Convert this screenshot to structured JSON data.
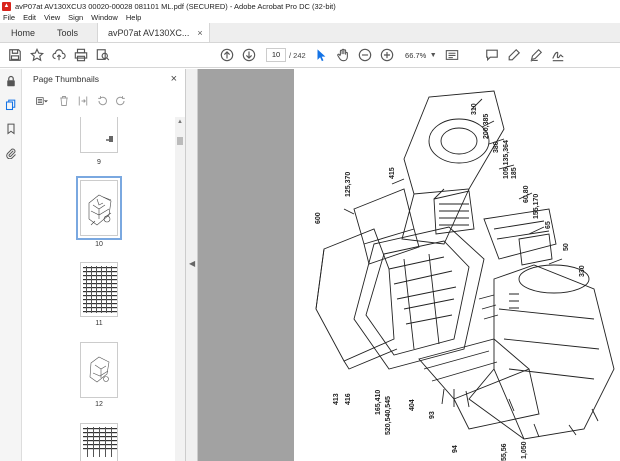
{
  "window": {
    "title": "avP07at AV130XCU3 00020-00028 081101 ML.pdf (SECURED) - Adobe Acrobat Pro DC (32-bit)"
  },
  "menu": [
    "File",
    "Edit",
    "View",
    "Sign",
    "Window",
    "Help"
  ],
  "tabs": {
    "home": "Home",
    "tools": "Tools",
    "document": "avP07at AV130XC...",
    "close": "×"
  },
  "toolbar": {
    "current_page": "10",
    "total_pages": "/ 242",
    "zoom": "66.7%"
  },
  "panel": {
    "title": "Page Thumbnails",
    "close": "×"
  },
  "thumbnails": [
    {
      "label": "9"
    },
    {
      "label": "10"
    },
    {
      "label": "11"
    },
    {
      "label": "12"
    }
  ],
  "drawing_labels": [
    "310",
    "200,385",
    "380",
    "105,135,364",
    "185",
    "60,80",
    "155,170",
    "415",
    "125,370",
    "600",
    "65",
    "50",
    "330",
    "413",
    "416",
    "165,410",
    "520,540,545",
    "404",
    "93",
    "94",
    "55,56",
    "1,050"
  ],
  "colors": {
    "accent": "#1473e6",
    "doc_background": "#a2a2a2",
    "selection": "#7aa8e0"
  }
}
